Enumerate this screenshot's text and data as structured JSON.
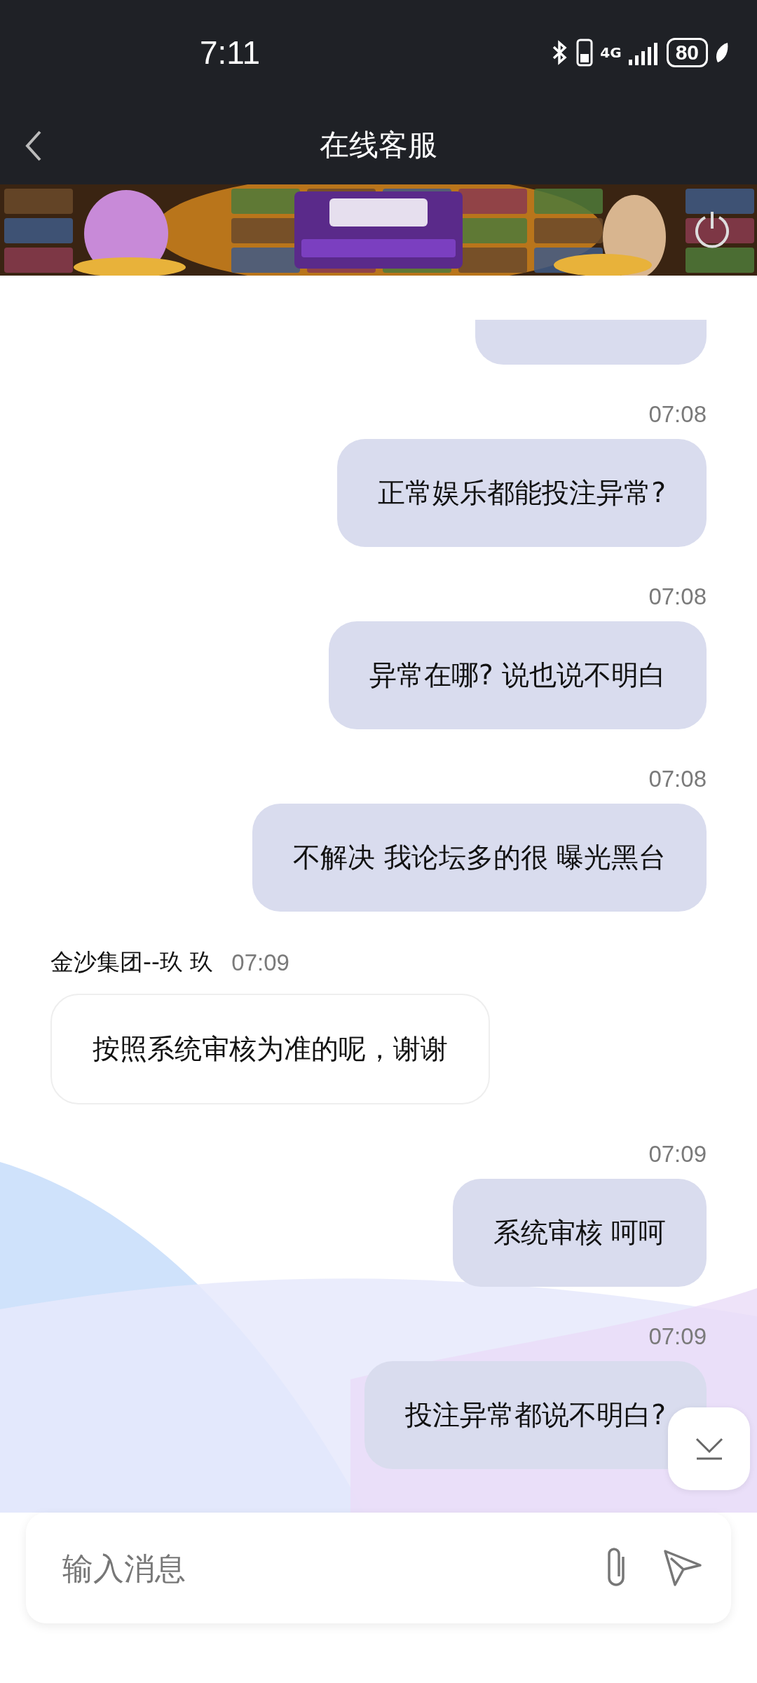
{
  "status_bar": {
    "time": "7:11",
    "network": "4G",
    "battery": "80"
  },
  "header": {
    "title": "在线客服"
  },
  "messages": [
    {
      "kind": "clipped"
    },
    {
      "kind": "outgoing",
      "time": "07:08",
      "text": "正常娱乐都能投注异常?"
    },
    {
      "kind": "outgoing",
      "time": "07:08",
      "text": "异常在哪?  说也说不明白"
    },
    {
      "kind": "outgoing",
      "time": "07:08",
      "text": "不解决 我论坛多的很 曝光黑台"
    },
    {
      "kind": "incoming",
      "sender": "金沙集团--玖 玖",
      "time": "07:09",
      "text": "按照系统审核为准的呢，谢谢"
    },
    {
      "kind": "outgoing",
      "time": "07:09",
      "text": "系统审核 呵呵"
    },
    {
      "kind": "outgoing",
      "time": "07:09",
      "text": "投注异常都说不明白?"
    }
  ],
  "composer": {
    "placeholder": "输入消息"
  }
}
